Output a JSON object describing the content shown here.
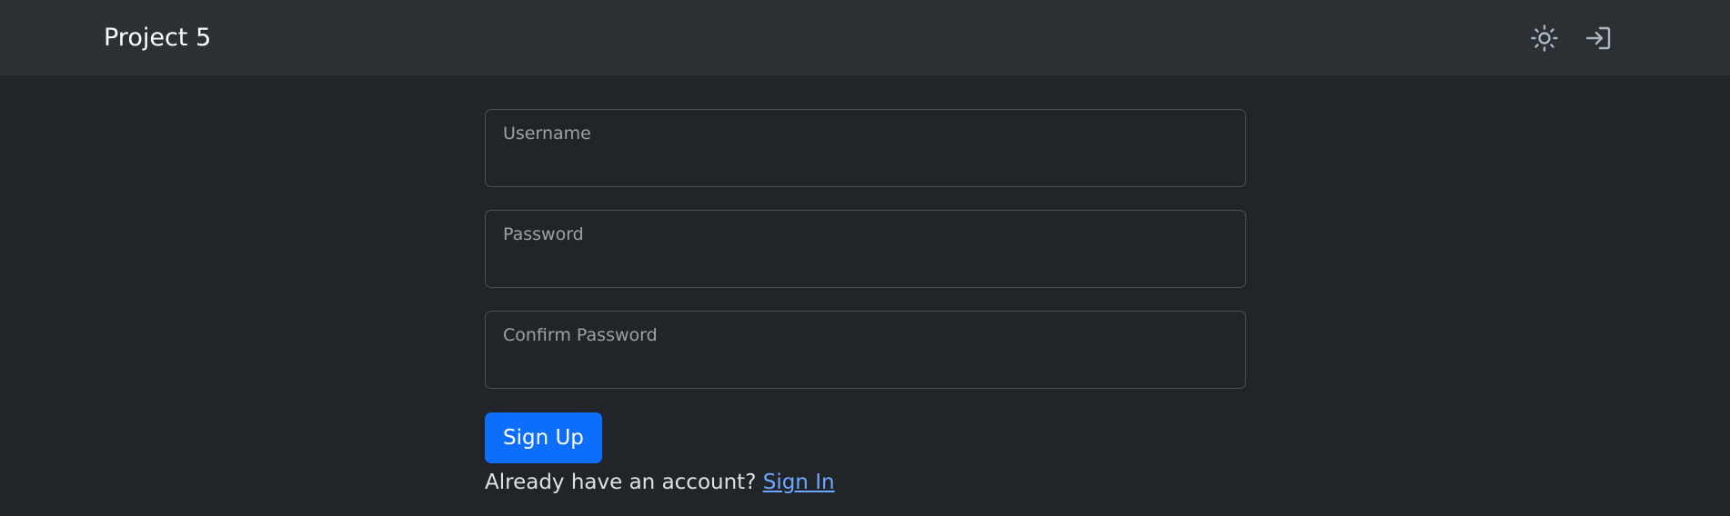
{
  "navbar": {
    "brand": "Project 5",
    "icons": {
      "theme": "sun-icon",
      "login": "sign-in-icon"
    }
  },
  "form": {
    "username": {
      "label": "Username",
      "value": ""
    },
    "password": {
      "label": "Password",
      "value": ""
    },
    "confirm_password": {
      "label": "Confirm Password",
      "value": ""
    },
    "submit_label": "Sign Up",
    "account_prompt": "Already have an account?",
    "sign_in_link": "Sign In"
  },
  "colors": {
    "background": "#212529",
    "navbar": "#2b3035",
    "primary": "#0d6efd",
    "link": "#6ea8fe"
  }
}
